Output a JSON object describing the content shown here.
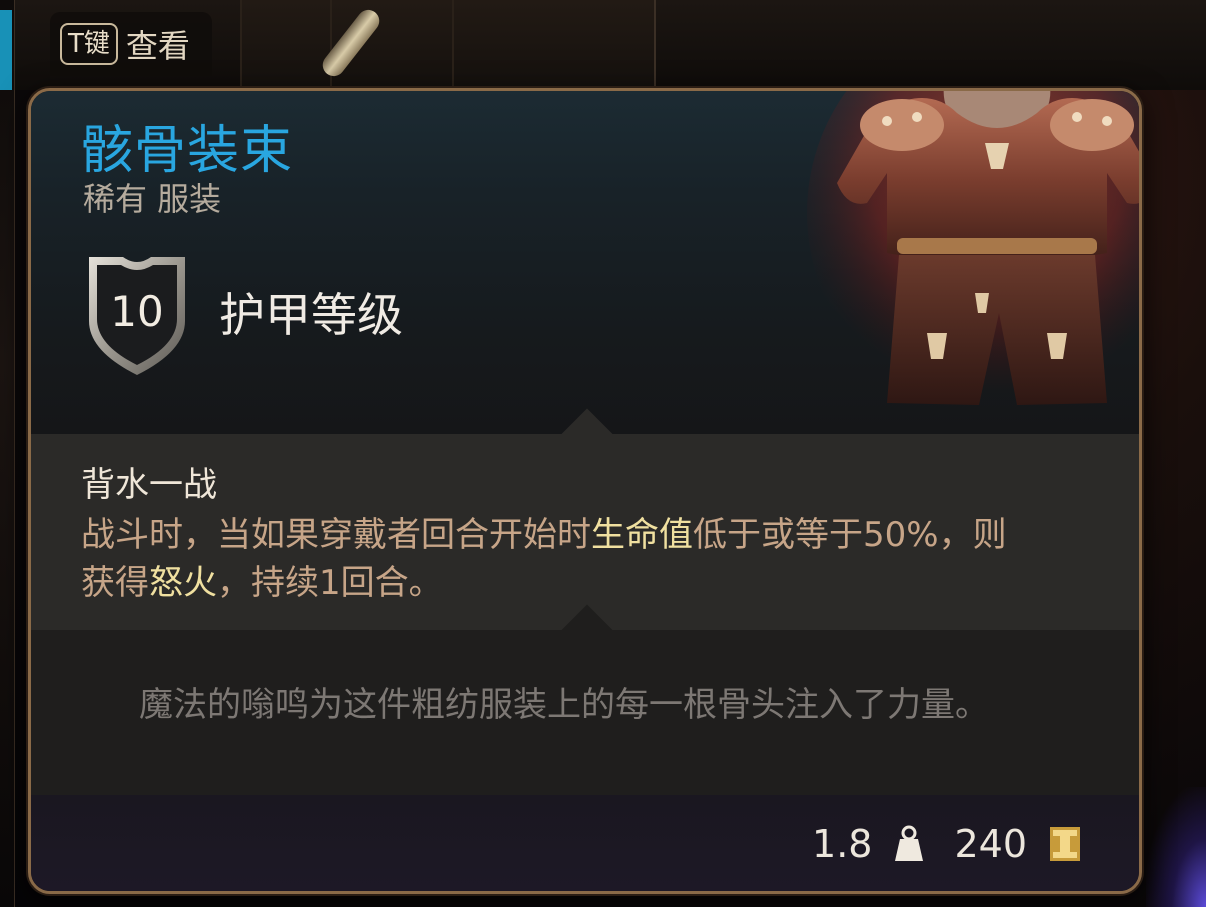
{
  "hint": {
    "key": "T键",
    "label": "查看"
  },
  "item": {
    "name": "骸骨装束",
    "rarity_type": "稀有 服装",
    "armor_class_value": "10",
    "armor_class_label": "护甲等级",
    "name_color": "#29a6e0",
    "art_icon": "bone-robe-armor-icon"
  },
  "passive": {
    "name": "背水一战",
    "desc_part1": "战斗时，当如果穿戴者回合开始时",
    "keyword1": "生命值",
    "desc_part2": "低于或等于50%，则获得",
    "keyword2": "怒火",
    "desc_part3": "，持续1回合。",
    "highlight_color": "#f0e0a0"
  },
  "flavor_text": "魔法的嗡鸣为这件粗纺服装上的每一根骨头注入了力量。",
  "footer": {
    "weight": "1.8",
    "weight_icon": "weight-icon",
    "value": "240",
    "value_icon": "gold-coin-icon"
  }
}
